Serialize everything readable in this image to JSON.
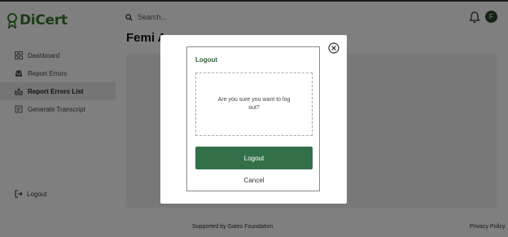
{
  "app": {
    "logo_text": "DiCert",
    "brand_color": "#3a7a2e",
    "search_placeholder": "Search...",
    "avatar_initial": "F"
  },
  "sidebar": {
    "items": [
      {
        "label": "Dashboard",
        "icon": "grid-icon"
      },
      {
        "label": "Report Errors",
        "icon": "inbox-icon"
      },
      {
        "label": "Report Errors List",
        "icon": "list-inbox-icon",
        "active": true
      },
      {
        "label": "Generate Transcript",
        "icon": "document-icon"
      }
    ],
    "logout_label": "Logout"
  },
  "main": {
    "page_title": "Femi A"
  },
  "footer": {
    "supported_by": "Supported by Gates Foundation",
    "privacy_link": "Privacy Policy"
  },
  "modal": {
    "title": "Logout",
    "message": "Are you sure you want to log out?",
    "confirm_label": "Logout",
    "cancel_label": "Cancel",
    "confirm_color": "#33704a"
  }
}
